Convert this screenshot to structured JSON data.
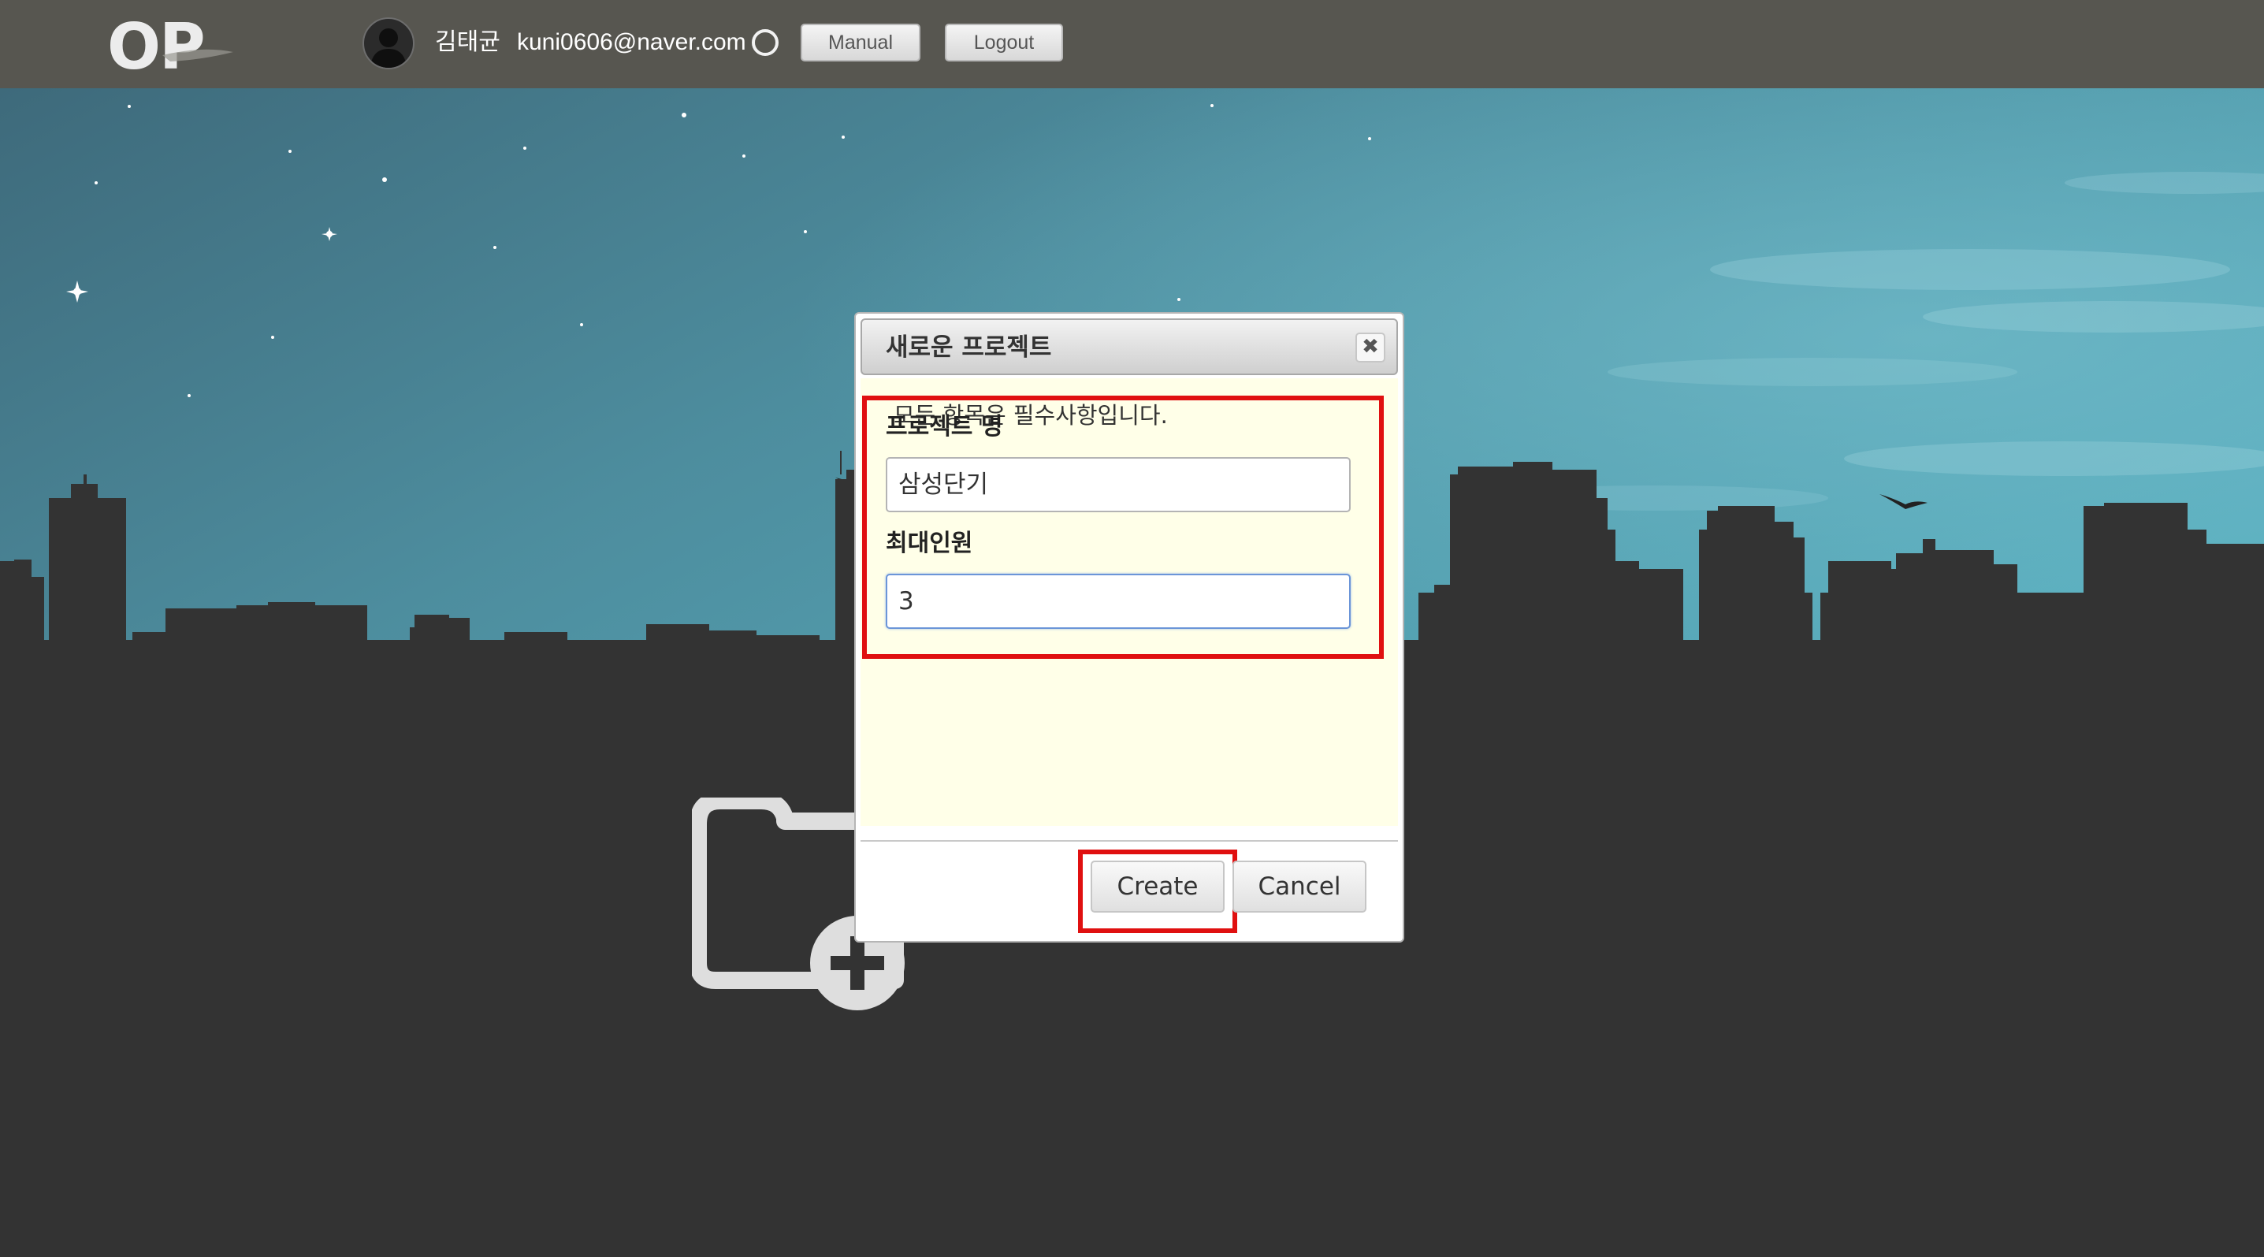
{
  "header": {
    "logo_text": "OP",
    "user_name": "김태균",
    "user_email": "kuni0606@naver.com",
    "manual_label": "Manual",
    "logout_label": "Logout"
  },
  "icons": {
    "avatar": "user-avatar-icon",
    "status": "status-ring-icon",
    "new_project": "folder-plus-icon",
    "close": "close-icon"
  },
  "dialog": {
    "title": "새로운 프로젝트",
    "close_symbol": "✖",
    "note": "모든 항목은 필수사항입니다.",
    "fields": {
      "project_name_label": "프로젝트 명",
      "project_name_value": "삼성단기",
      "max_members_label": "최대인원",
      "max_members_value": "3"
    },
    "create_label": "Create",
    "cancel_label": "Cancel"
  },
  "colors": {
    "header_bg": "#575650",
    "sky_top": "#3f6f80",
    "sky_bottom": "#56a3b3",
    "ground": "#333333",
    "dialog_body": "#ffffe8",
    "highlight": "#e01010"
  }
}
